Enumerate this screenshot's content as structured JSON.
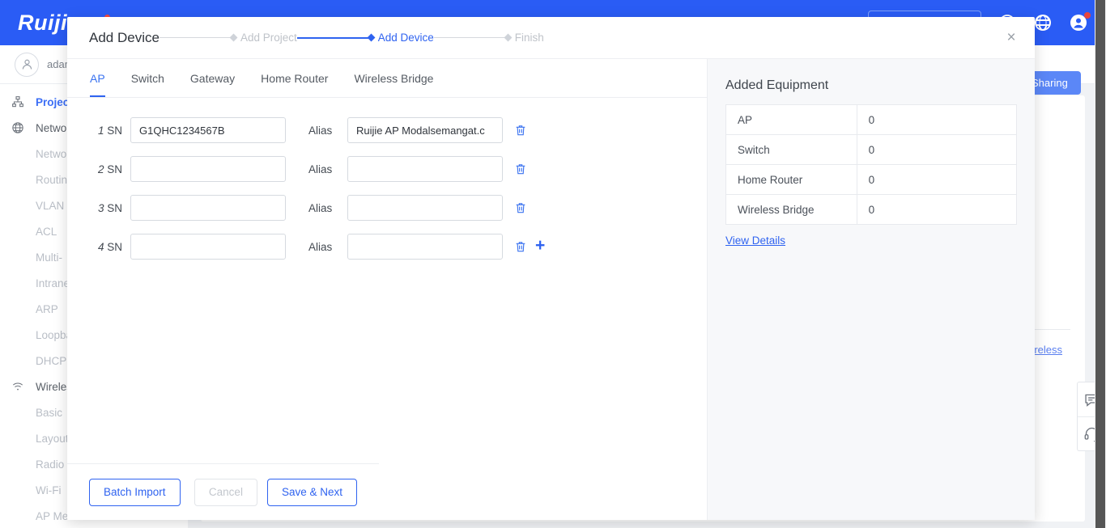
{
  "topbar": {
    "brand": "Ruijie",
    "sharing_button": "Sharing",
    "icons": {
      "globe": "globe-icon",
      "account": "account-icon",
      "help": "help-icon"
    }
  },
  "userbar": {
    "username": "adam"
  },
  "sidebar": {
    "groups": [
      {
        "label": "Project",
        "icon": "sitemap-icon",
        "active": true,
        "children": []
      },
      {
        "label": "Network",
        "icon": "globe-icon",
        "active": false,
        "children": [
          "Network",
          "Routing",
          "VLAN",
          "ACL",
          "Multi-",
          "Intranet",
          "ARP",
          "Loopback",
          "DHCP"
        ]
      },
      {
        "label": "Wireless",
        "icon": "wifi-icon",
        "active": false,
        "children": [
          "Basic",
          "Layout",
          "Radio",
          "Wi-Fi",
          "AP Mesh"
        ]
      }
    ]
  },
  "background_content": {
    "link": "Wireless"
  },
  "side_widgets": [
    {
      "name": "feedback-icon"
    },
    {
      "name": "support-headset-icon"
    }
  ],
  "modal": {
    "title": "Add Device",
    "close_label": "×",
    "steps": [
      {
        "label": "Add Project",
        "state": "done"
      },
      {
        "label": "Add Device",
        "state": "active"
      },
      {
        "label": "Finish",
        "state": "pending"
      }
    ],
    "tabs": [
      {
        "label": "AP",
        "active": true
      },
      {
        "label": "Switch",
        "active": false
      },
      {
        "label": "Gateway",
        "active": false
      },
      {
        "label": "Home Router",
        "active": false
      },
      {
        "label": "Wireless Bridge",
        "active": false
      }
    ],
    "form": {
      "sn_label": "SN",
      "alias_label": "Alias",
      "sn_placeholder": "",
      "alias_placeholder": "",
      "delete_icon": "trash-icon",
      "add_icon": "plus-icon",
      "rows": [
        {
          "index": "1",
          "sn": "G1QHC1234567B",
          "alias": "Ruijie AP Modalsemangat.c"
        },
        {
          "index": "2",
          "sn": "",
          "alias": ""
        },
        {
          "index": "3",
          "sn": "",
          "alias": ""
        },
        {
          "index": "4",
          "sn": "",
          "alias": ""
        }
      ]
    },
    "added_equipment": {
      "title": "Added Equipment",
      "rows": [
        {
          "type": "AP",
          "count": "0"
        },
        {
          "type": "Switch",
          "count": "0"
        },
        {
          "type": "Home Router",
          "count": "0"
        },
        {
          "type": "Wireless Bridge",
          "count": "0"
        }
      ],
      "view_details": "View Details"
    },
    "footer": {
      "batch_import": "Batch Import",
      "cancel": "Cancel",
      "save_next": "Save & Next"
    }
  },
  "colors": {
    "brand_blue": "#2a5cf5",
    "accent": "#2f63f0",
    "muted": "#bfc3c9",
    "badge_red": "#e8453c"
  }
}
